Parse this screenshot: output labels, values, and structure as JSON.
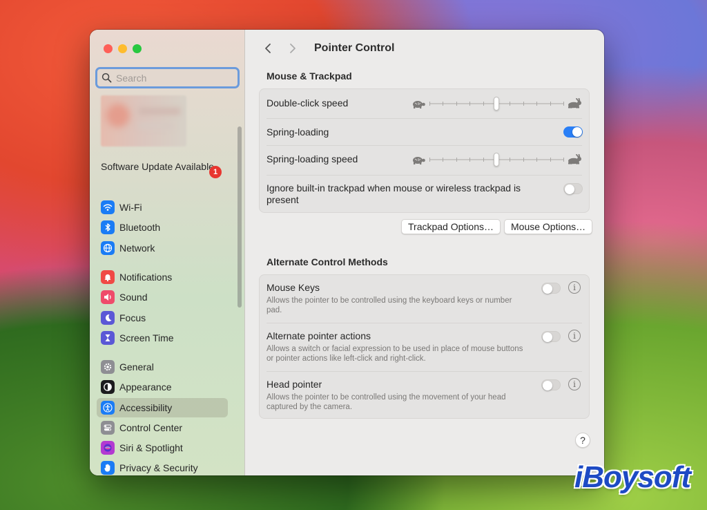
{
  "sidebar": {
    "search_placeholder": "Search",
    "update_label": "Software Update Available",
    "update_badge": "1",
    "groups": [
      [
        {
          "label": "Wi-Fi",
          "icon": "wifi-icon",
          "color": "#1a7cf5"
        },
        {
          "label": "Bluetooth",
          "icon": "bluetooth-icon",
          "color": "#1a7cf5"
        },
        {
          "label": "Network",
          "icon": "globe-icon",
          "color": "#1a7cf5"
        }
      ],
      [
        {
          "label": "Notifications",
          "icon": "bell-icon",
          "color": "#f04a45"
        },
        {
          "label": "Sound",
          "icon": "speaker-icon",
          "color": "#ef4b6a"
        },
        {
          "label": "Focus",
          "icon": "moon-icon",
          "color": "#5b58d6"
        },
        {
          "label": "Screen Time",
          "icon": "hourglass-icon",
          "color": "#5b58d6"
        }
      ],
      [
        {
          "label": "General",
          "icon": "gear-icon",
          "color": "#8e8e93"
        },
        {
          "label": "Appearance",
          "icon": "appearance-icon",
          "color": "#1c1c1e"
        },
        {
          "label": "Accessibility",
          "icon": "accessibility-icon",
          "color": "#1a7cf5",
          "selected": true
        },
        {
          "label": "Control Center",
          "icon": "control-center-icon",
          "color": "#8e8e93"
        },
        {
          "label": "Siri & Spotlight",
          "icon": "siri-icon",
          "color": "#b33ad1"
        },
        {
          "label": "Privacy & Security",
          "icon": "hand-icon",
          "color": "#1a7cf5"
        }
      ]
    ]
  },
  "main": {
    "title": "Pointer Control",
    "section1": {
      "title": "Mouse & Trackpad",
      "double_click_label": "Double-click speed",
      "double_click_value": 0.5,
      "spring_loading_label": "Spring-loading",
      "spring_loading_on": true,
      "spring_speed_label": "Spring-loading speed",
      "spring_speed_value": 0.5,
      "ignore_label": "Ignore built-in trackpad when mouse or wireless trackpad is present",
      "ignore_on": false,
      "trackpad_button": "Trackpad Options…",
      "mouse_button": "Mouse Options…"
    },
    "section2": {
      "title": "Alternate Control Methods",
      "rows": [
        {
          "label": "Mouse Keys",
          "desc": "Allows the pointer to be controlled using the keyboard keys or number pad.",
          "on": false
        },
        {
          "label": "Alternate pointer actions",
          "desc": "Allows a switch or facial expression to be used in place of mouse buttons or pointer actions like left-click and right-click.",
          "on": false
        },
        {
          "label": "Head pointer",
          "desc": "Allows the pointer to be controlled using the movement of your head captured by the camera.",
          "on": false
        }
      ]
    },
    "help": "?"
  },
  "watermark": "iBoysoft"
}
